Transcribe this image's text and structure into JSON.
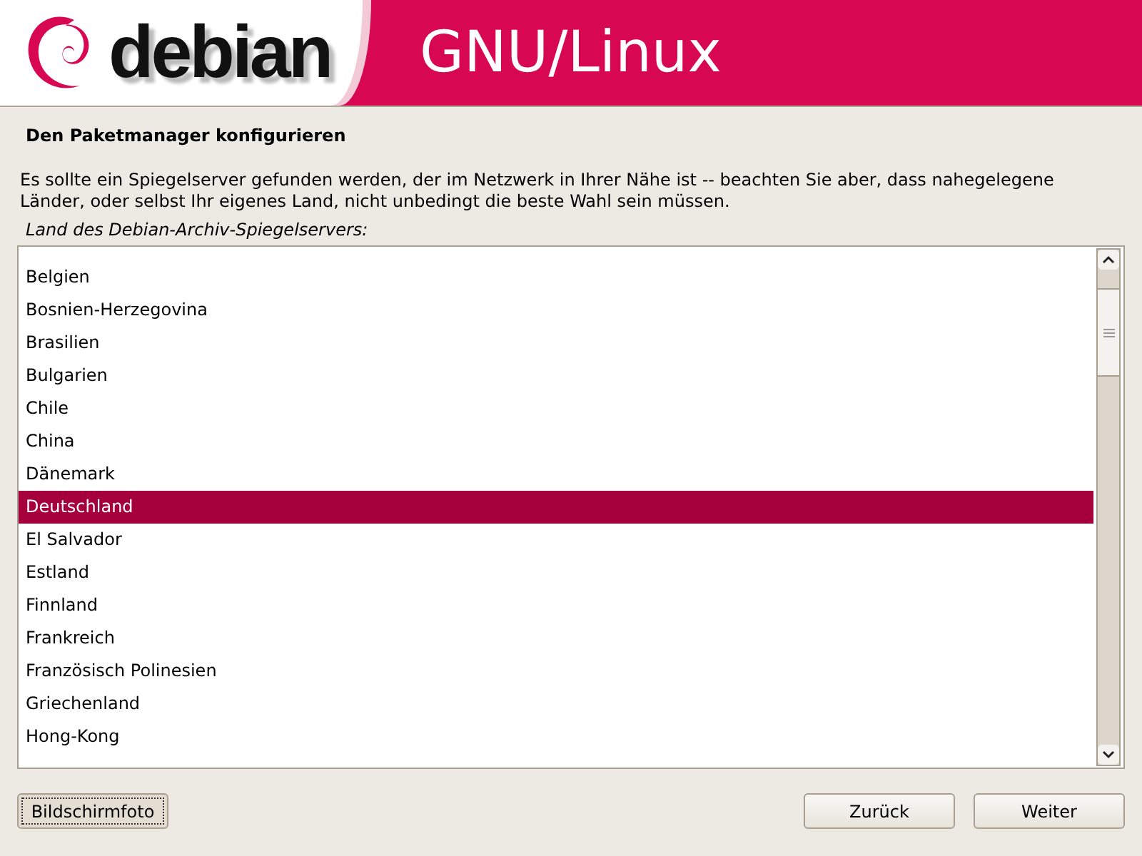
{
  "header": {
    "logo_text": "debian",
    "title": "GNU/Linux"
  },
  "page": {
    "title": "Den Paketmanager konfigurieren",
    "description": "Es sollte ein Spiegelserver gefunden werden, der im Netzwerk in Ihrer Nähe ist -- beachten Sie aber, dass nahegelegene Länder, oder selbst Ihr eigenes Land, nicht unbedingt die beste Wahl sein müssen.",
    "list_label": "Land des Debian-Archiv-Spiegelservers:"
  },
  "countries": [
    {
      "label": "Belgien",
      "selected": false
    },
    {
      "label": "Bosnien-Herzegovina",
      "selected": false
    },
    {
      "label": "Brasilien",
      "selected": false
    },
    {
      "label": "Bulgarien",
      "selected": false
    },
    {
      "label": "Chile",
      "selected": false
    },
    {
      "label": "China",
      "selected": false
    },
    {
      "label": "Dänemark",
      "selected": false
    },
    {
      "label": "Deutschland",
      "selected": true
    },
    {
      "label": "El Salvador",
      "selected": false
    },
    {
      "label": "Estland",
      "selected": false
    },
    {
      "label": "Finnland",
      "selected": false
    },
    {
      "label": "Frankreich",
      "selected": false
    },
    {
      "label": "Französisch Polinesien",
      "selected": false
    },
    {
      "label": "Griechenland",
      "selected": false
    },
    {
      "label": "Hong-Kong",
      "selected": false
    }
  ],
  "buttons": {
    "screenshot": "Bildschirmfoto",
    "back": "Zurück",
    "next": "Weiter"
  }
}
